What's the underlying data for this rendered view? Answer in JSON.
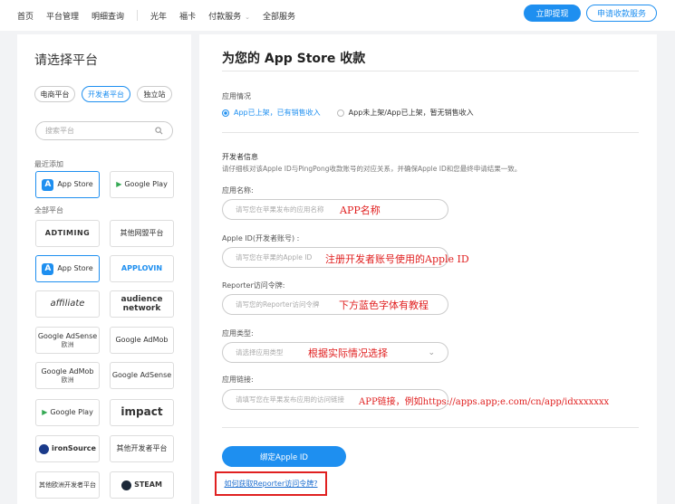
{
  "nav": {
    "items": [
      "首页",
      "平台管理",
      "明细查询",
      "光年",
      "福卡",
      "付款服务",
      "全部服务"
    ],
    "withdraw_button": "立即提现",
    "apply_button": "申请收款服务"
  },
  "left": {
    "title": "请选择平台",
    "tabs": [
      "电商平台",
      "开发者平台",
      "独立站"
    ],
    "search_placeholder": "搜索平台",
    "recent_label": "最近添加",
    "all_label": "全部平台",
    "recent": [
      "App Store",
      "Google Play"
    ],
    "platforms": [
      {
        "name": "ADTIMING",
        "sub": ""
      },
      {
        "name": "其他网盟平台",
        "sub": ""
      },
      {
        "name": "App Store",
        "sub": ""
      },
      {
        "name": "APPLOVIN",
        "sub": ""
      },
      {
        "name": "affiliate",
        "sub": ""
      },
      {
        "name": "audience network",
        "sub": ""
      },
      {
        "name": "Google AdSense",
        "sub": "欧洲"
      },
      {
        "name": "Google AdMob",
        "sub": ""
      },
      {
        "name": "Google AdMob",
        "sub": "欧洲"
      },
      {
        "name": "Google AdSense",
        "sub": ""
      },
      {
        "name": "Google Play",
        "sub": ""
      },
      {
        "name": "impact",
        "sub": ""
      },
      {
        "name": "ironSource",
        "sub": ""
      },
      {
        "name": "其他开发者平台",
        "sub": ""
      },
      {
        "name": "其他欧洲开发者平台",
        "sub": ""
      },
      {
        "name": "STEAM",
        "sub": ""
      }
    ]
  },
  "right": {
    "title": "为您的 App Store 收款",
    "app_status_label": "应用情况",
    "radio_listed": "App已上架，已有销售收入",
    "radio_unlisted": "App未上架/App已上架，暂无销售收入",
    "dev_info_label": "开发者信息",
    "dev_info_desc": "请仔细核对该Apple ID与PingPong收款账号的对应关系，并确保Apple ID和您最终申请结果一致。",
    "fields": [
      {
        "label": "应用名称:",
        "placeholder": "请写您在苹果发布的应用名称",
        "note": "APP名称"
      },
      {
        "label": "Apple ID(开发者账号) :",
        "placeholder": "请写您在苹果的Apple ID",
        "note": "注册开发者账号使用的Apple ID"
      },
      {
        "label": "Reporter访问令牌:",
        "placeholder": "请写您的Reporter访问令牌",
        "note": "下方蓝色字体有教程"
      },
      {
        "label": "应用类型:",
        "placeholder": "请选择应用类型",
        "note": "根据实际情况选择"
      },
      {
        "label": "应用链接:",
        "placeholder": "请填写您在苹果发布应用的访问链接",
        "note": "APP链接，例如https://apps.app;e.com/cn/app/idxxxxxxx"
      }
    ],
    "bind_button": "绑定Apple ID",
    "help_link": "如何获取Reporter访问令牌?"
  }
}
